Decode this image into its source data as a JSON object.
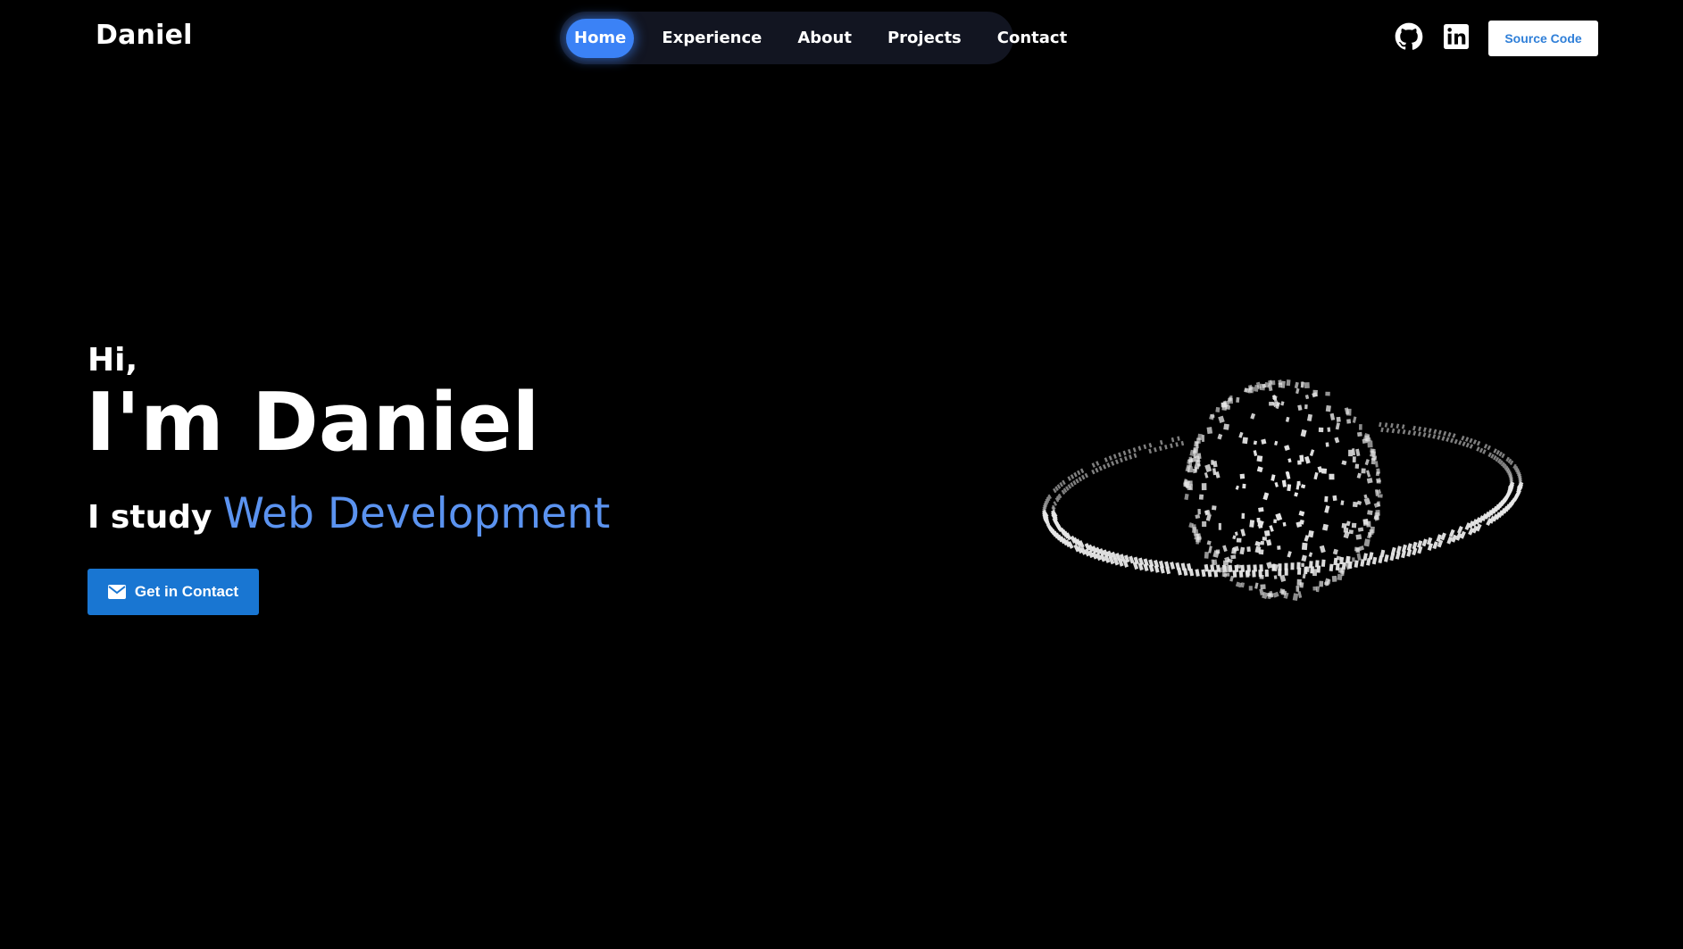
{
  "header": {
    "brand": "Daniel",
    "source_code_label": "Source Code"
  },
  "nav": {
    "items": [
      {
        "label": "Home",
        "active": true
      },
      {
        "label": "Experience",
        "active": false
      },
      {
        "label": "About",
        "active": false
      },
      {
        "label": "Projects",
        "active": false
      },
      {
        "label": "Contact",
        "active": false
      }
    ]
  },
  "social": {
    "icons": [
      "github-icon",
      "linkedin-icon"
    ]
  },
  "hero": {
    "greeting": "Hi,",
    "name": "I'm Daniel",
    "study_prefix": "I study",
    "study_field": "Web Development",
    "cta_label": "Get in Contact",
    "cta_icon": "mail-icon"
  },
  "colors": {
    "background": "#000000",
    "accent": "#3b82f6",
    "field_text": "#5b93f0",
    "cta_button": "#1976d2",
    "nav_bg": "#121521",
    "particles": "#e8e8e8"
  },
  "graphic": {
    "icon": "particle-planet-icon"
  }
}
